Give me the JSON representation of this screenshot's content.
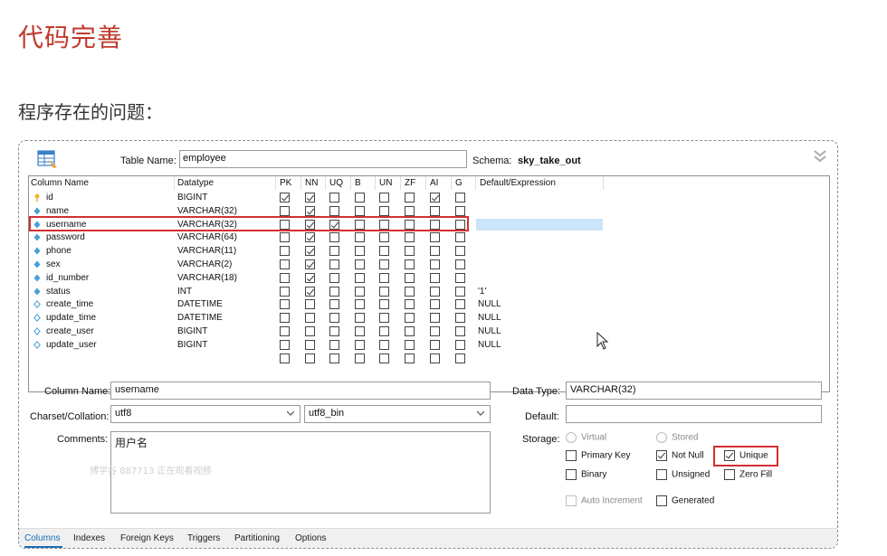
{
  "slide": {
    "title": "代码完善",
    "subtitle": "程序存在的问题："
  },
  "editor": {
    "table_name_label": "Table Name:",
    "table_name": "employee",
    "schema_label": "Schema:",
    "schema": "sky_take_out",
    "columns_header": [
      "Column Name",
      "Datatype",
      "PK",
      "NN",
      "UQ",
      "B",
      "UN",
      "ZF",
      "AI",
      "G",
      "Default/Expression"
    ],
    "rows": [
      {
        "name": "id",
        "type": "BIGINT",
        "icon": "key-icon",
        "flags": [
          1,
          1,
          0,
          0,
          0,
          0,
          1,
          0
        ],
        "default": ""
      },
      {
        "name": "name",
        "type": "VARCHAR(32)",
        "icon": "column-icon",
        "flags": [
          0,
          1,
          0,
          0,
          0,
          0,
          0,
          0
        ],
        "default": ""
      },
      {
        "name": "username",
        "type": "VARCHAR(32)",
        "icon": "column-icon",
        "flags": [
          0,
          1,
          1,
          0,
          0,
          0,
          0,
          0
        ],
        "default": "",
        "selected": true
      },
      {
        "name": "password",
        "type": "VARCHAR(64)",
        "icon": "column-icon",
        "flags": [
          0,
          1,
          0,
          0,
          0,
          0,
          0,
          0
        ],
        "default": ""
      },
      {
        "name": "phone",
        "type": "VARCHAR(11)",
        "icon": "column-icon",
        "flags": [
          0,
          1,
          0,
          0,
          0,
          0,
          0,
          0
        ],
        "default": ""
      },
      {
        "name": "sex",
        "type": "VARCHAR(2)",
        "icon": "column-icon",
        "flags": [
          0,
          1,
          0,
          0,
          0,
          0,
          0,
          0
        ],
        "default": ""
      },
      {
        "name": "id_number",
        "type": "VARCHAR(18)",
        "icon": "column-icon",
        "flags": [
          0,
          1,
          0,
          0,
          0,
          0,
          0,
          0
        ],
        "default": ""
      },
      {
        "name": "status",
        "type": "INT",
        "icon": "column-icon",
        "flags": [
          0,
          1,
          0,
          0,
          0,
          0,
          0,
          0
        ],
        "default": "'1'"
      },
      {
        "name": "create_time",
        "type": "DATETIME",
        "icon": "nullable-column-icon",
        "flags": [
          0,
          0,
          0,
          0,
          0,
          0,
          0,
          0
        ],
        "default": "NULL"
      },
      {
        "name": "update_time",
        "type": "DATETIME",
        "icon": "nullable-column-icon",
        "flags": [
          0,
          0,
          0,
          0,
          0,
          0,
          0,
          0
        ],
        "default": "NULL"
      },
      {
        "name": "create_user",
        "type": "BIGINT",
        "icon": "nullable-column-icon",
        "flags": [
          0,
          0,
          0,
          0,
          0,
          0,
          0,
          0
        ],
        "default": "NULL"
      },
      {
        "name": "update_user",
        "type": "BIGINT",
        "icon": "nullable-column-icon",
        "flags": [
          0,
          0,
          0,
          0,
          0,
          0,
          0,
          0
        ],
        "default": "NULL"
      },
      {
        "name": "",
        "type": "",
        "icon": "",
        "flags": [
          0,
          0,
          0,
          0,
          0,
          0,
          0,
          0
        ],
        "default": ""
      }
    ],
    "details": {
      "column_name_label": "Column Name:",
      "column_name": "username",
      "data_type_label": "Data Type:",
      "data_type": "VARCHAR(32)",
      "charset_label": "Charset/Collation:",
      "charset": "utf8",
      "collation": "utf8_bin",
      "default_label": "Default:",
      "default_value": "",
      "comments_label": "Comments:",
      "comments": "用户名",
      "watermark": "博学谷 887713 正在观看视频",
      "storage_label": "Storage:",
      "virtual": "Virtual",
      "stored": "Stored",
      "primary_key": "Primary Key",
      "not_null": "Not Null",
      "unique": "Unique",
      "binary": "Binary",
      "unsigned": "Unsigned",
      "zero_fill": "Zero Fill",
      "auto_increment": "Auto Increment",
      "generated": "Generated"
    },
    "tabs": [
      "Columns",
      "Indexes",
      "Foreign Keys",
      "Triggers",
      "Partitioning",
      "Options"
    ]
  },
  "colors": {
    "title_red": "#c0392b",
    "highlight_red": "#d32f2f",
    "selection_blue": "#cce4f7",
    "active_tab": "#1a6fb5"
  }
}
